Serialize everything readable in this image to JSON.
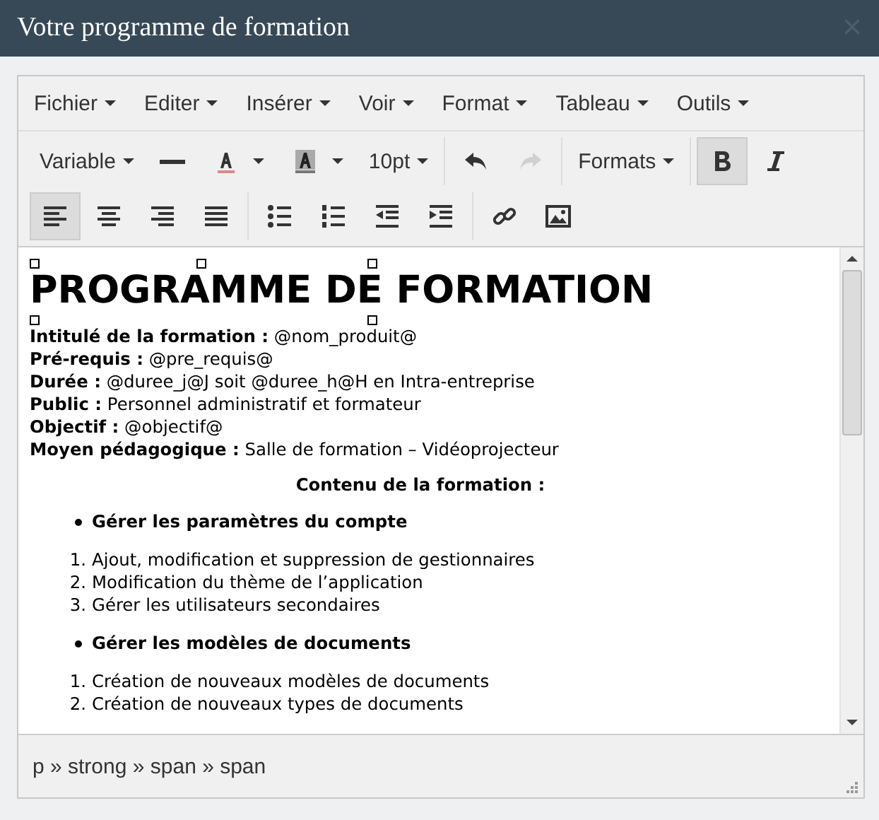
{
  "window": {
    "title": "Votre programme de formation",
    "close": "×"
  },
  "menubar": [
    {
      "label": "Fichier"
    },
    {
      "label": "Editer"
    },
    {
      "label": "Insérer"
    },
    {
      "label": "Voir"
    },
    {
      "label": "Format"
    },
    {
      "label": "Tableau"
    },
    {
      "label": "Outils"
    }
  ],
  "toolbar_rows": [
    [
      [
        {
          "kind": "dropdown",
          "label": "Variable"
        },
        {
          "kind": "button",
          "active": false,
          "disabled": false
        },
        {
          "kind": "split",
          "active": false,
          "disabled": false
        },
        {
          "kind": "split",
          "active": false,
          "disabled": false
        },
        {
          "kind": "dropdown",
          "label": "10pt"
        }
      ],
      [
        {
          "kind": "button",
          "active": false,
          "disabled": false
        },
        {
          "kind": "button",
          "active": false,
          "disabled": true
        }
      ],
      [
        {
          "kind": "dropdown",
          "label": "Formats"
        }
      ],
      [
        {
          "kind": "button",
          "active": true,
          "disabled": false
        },
        {
          "kind": "button",
          "active": false,
          "disabled": false
        }
      ]
    ],
    [
      [
        {
          "kind": "button",
          "active": true,
          "disabled": false
        },
        {
          "kind": "button",
          "active": false,
          "disabled": false
        },
        {
          "kind": "button",
          "active": false,
          "disabled": false
        },
        {
          "kind": "button",
          "active": false,
          "disabled": false
        }
      ],
      [
        {
          "kind": "button",
          "active": false,
          "disabled": false
        },
        {
          "kind": "button",
          "active": false,
          "disabled": false
        },
        {
          "kind": "button",
          "active": false,
          "disabled": false
        },
        {
          "kind": "button",
          "active": false,
          "disabled": false
        }
      ],
      [
        {
          "kind": "button",
          "active": false,
          "disabled": false
        },
        {
          "kind": "button",
          "active": false,
          "disabled": false
        }
      ]
    ]
  ],
  "document": {
    "heading": "PROGRAMME DE FORMATION",
    "fields": [
      {
        "label": "Intitulé de la formation :",
        "value": "@nom_produit@"
      },
      {
        "label": "Pré-requis :",
        "value": "@pre_requis@"
      },
      {
        "label": "Durée :",
        "value": "@duree_j@J soit @duree_h@H en Intra-entreprise"
      },
      {
        "label": "Public :",
        "value": "Personnel administratif et formateur"
      },
      {
        "label": "Objectif :",
        "value": "@objectif@"
      },
      {
        "label": "Moyen pédagogique :",
        "value": "Salle de formation – Vidéoprojecteur"
      }
    ],
    "subheading": "Contenu de la formation :",
    "sections": [
      {
        "title": "Gérer les paramètres du compte",
        "items": [
          {
            "number": "1.",
            "text": "Ajout, modification et suppression de gestionnaires"
          },
          {
            "number": "2.",
            "text": "Modification du thème de l’application"
          },
          {
            "number": "3.",
            "text": "Gérer les utilisateurs secondaires"
          }
        ]
      },
      {
        "title": "Gérer les modèles de documents",
        "items": [
          {
            "number": "1.",
            "text": "Création de nouveaux modèles de documents"
          },
          {
            "number": "2.",
            "text": "Création de nouveaux types de documents"
          }
        ]
      }
    ]
  },
  "status_bar": {
    "path": "p » strong » span » span"
  }
}
